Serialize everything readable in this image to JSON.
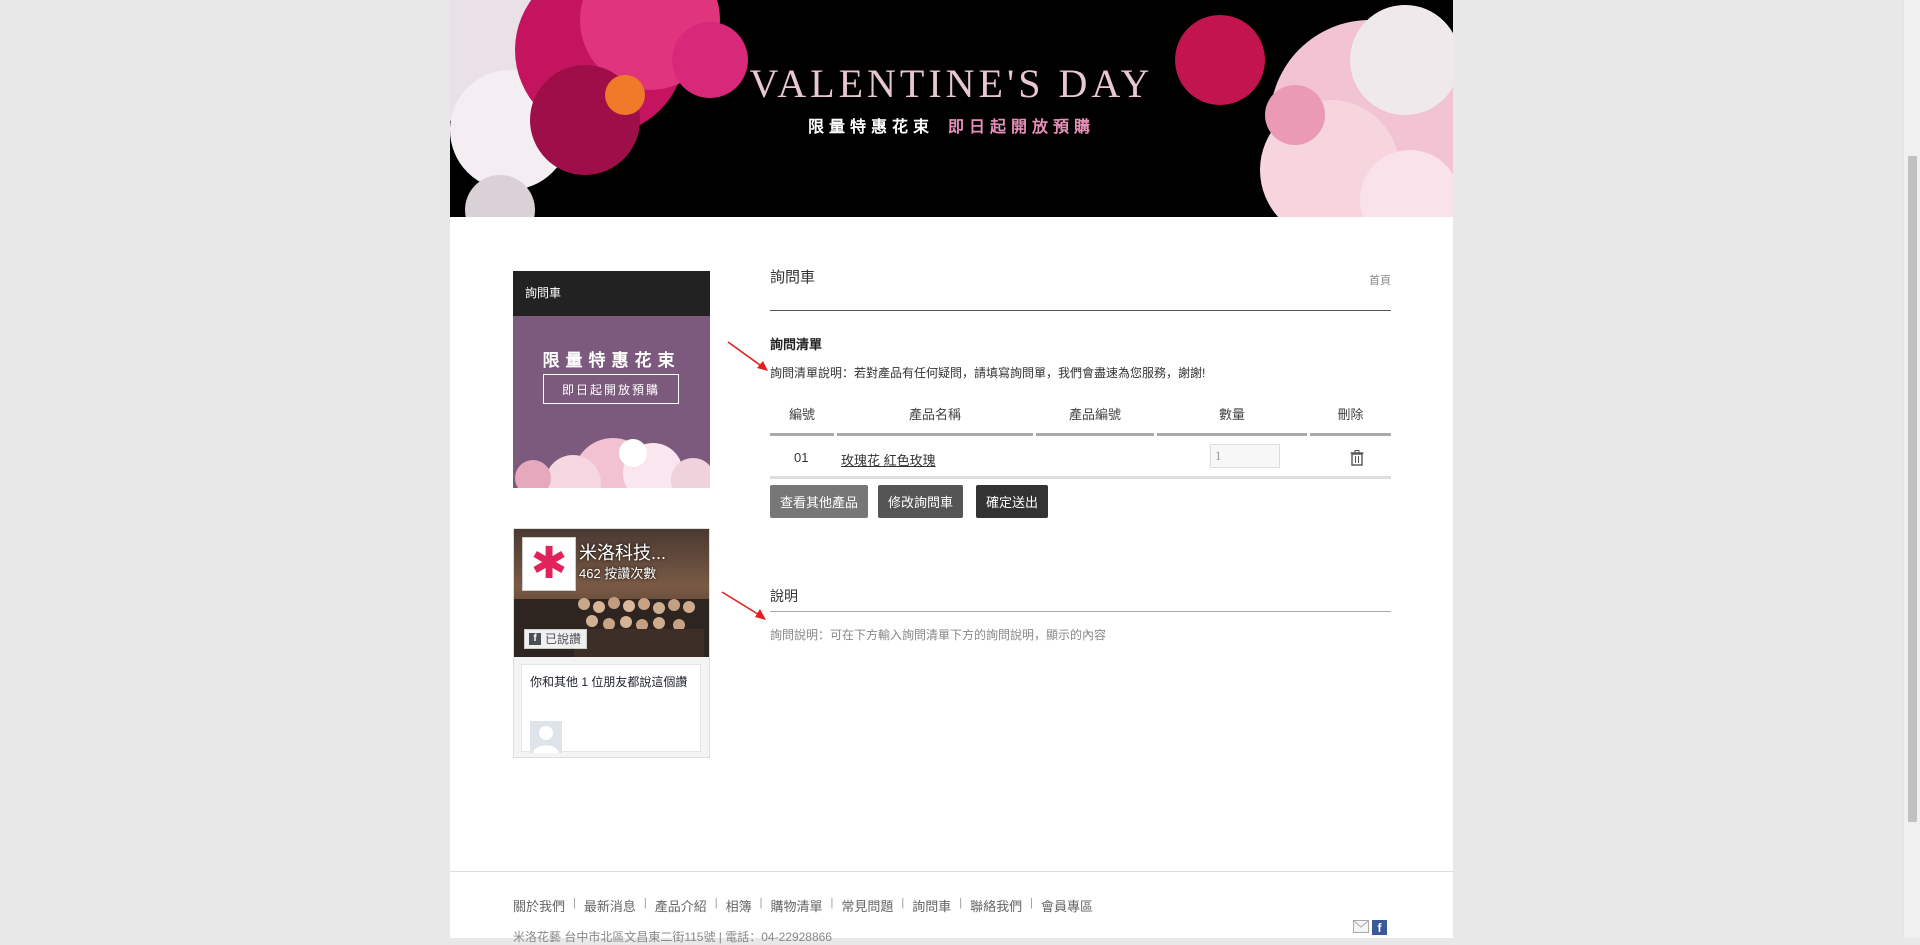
{
  "banner": {
    "title": "VALENTINE'S DAY",
    "sub_white": "限量特惠花束",
    "sub_pink": "即日起開放預購"
  },
  "sidebar": {
    "heading": "詢問車",
    "promo_title": "限量特惠花束",
    "promo_button": "即日起開放預購",
    "fb": {
      "page_name": "米洛科技...",
      "likes": "462 按讚次數",
      "liked_label": "已說讚",
      "friends_text": "你和其他 1 位朋友都說這個讚"
    }
  },
  "main": {
    "title": "詢問車",
    "breadcrumb": "首頁",
    "list_heading": "詢問清單",
    "list_desc": "詢問清單說明：若對產品有任何疑問，請填寫詢問單，我們會盡速為您服務，謝謝!",
    "table": {
      "headers": [
        "編號",
        "產品名稱",
        "產品編號",
        "數量",
        "刪除"
      ],
      "rows": [
        {
          "no": "01",
          "name": "玫瑰花 紅色玫瑰",
          "code": "",
          "qty": "1"
        }
      ]
    },
    "buttons": {
      "other_products": "查看其他產品",
      "edit_cart": "修改詢問車",
      "submit": "確定送出"
    },
    "note_title": "說明",
    "note_text": "詢問說明：可在下方輸入詢問清單下方的詢問說明，顯示的內容"
  },
  "footer": {
    "nav": [
      "關於我們",
      "最新消息",
      "產品介紹",
      "相簿",
      "購物清單",
      "常見問題",
      "詢問車",
      "聯絡我們",
      "會員專區"
    ],
    "info": "米洛花藝 台中市北區文昌東二街115號 | 電話：04-22928866"
  },
  "colors": {
    "banner_bg": "#000000",
    "promo_bg": "#7c5a7e",
    "arrow": "#e02020",
    "fb_blue": "#3b5998"
  }
}
